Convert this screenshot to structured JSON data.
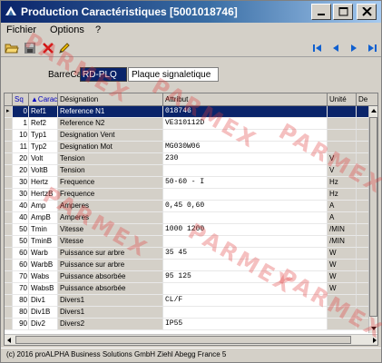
{
  "window": {
    "title": "Production Caractéristiques  [5001018746]"
  },
  "menu": {
    "items": [
      "Fichier",
      "Options",
      "?"
    ]
  },
  "form": {
    "barrecar_label": "BarreCar:",
    "barrecar_value": "RD-PLQ",
    "barrecar_desc": "Plaque signaletique"
  },
  "grid": {
    "headers": {
      "seq": "Sq",
      "carac": "Carac",
      "designation": "Désignation",
      "attribut": "Attribut",
      "unite": "Unité",
      "extra": "De"
    },
    "rows": [
      {
        "seq": "0",
        "carac": "Ref1",
        "designation": "Reference N1",
        "attribut": "018746",
        "unite": ""
      },
      {
        "seq": "1",
        "carac": "Ref2",
        "designation": "Reference N2",
        "attribut": "VE310112D",
        "unite": ""
      },
      {
        "seq": "10",
        "carac": "Typ1",
        "designation": "Designation Vent",
        "attribut": "",
        "unite": ""
      },
      {
        "seq": "11",
        "carac": "Typ2",
        "designation": "Designation Mot",
        "attribut": "MG030W06",
        "unite": ""
      },
      {
        "seq": "20",
        "carac": "Volt",
        "designation": "Tension",
        "attribut": "230",
        "unite": "V"
      },
      {
        "seq": "20",
        "carac": "VoltB",
        "designation": "Tension",
        "attribut": "",
        "unite": "V"
      },
      {
        "seq": "30",
        "carac": "Hertz",
        "designation": "Frequence",
        "attribut": "50-60 - I",
        "unite": "Hz"
      },
      {
        "seq": "30",
        "carac": "HertzB",
        "designation": "Frequence",
        "attribut": "",
        "unite": "Hz"
      },
      {
        "seq": "40",
        "carac": "Amp",
        "designation": "Amperes",
        "attribut": "0,45 0,60",
        "unite": "A"
      },
      {
        "seq": "40",
        "carac": "AmpB",
        "designation": "Amperes",
        "attribut": "",
        "unite": "A"
      },
      {
        "seq": "50",
        "carac": "Tmin",
        "designation": "Vitesse",
        "attribut": "1000 1200",
        "unite": "/MIN"
      },
      {
        "seq": "50",
        "carac": "TminB",
        "designation": "Vitesse",
        "attribut": "",
        "unite": "/MIN"
      },
      {
        "seq": "60",
        "carac": "Warb",
        "designation": "Puissance sur arbre",
        "attribut": "35 45",
        "unite": "W"
      },
      {
        "seq": "60",
        "carac": "WarbB",
        "designation": "Puissance sur arbre",
        "attribut": "",
        "unite": "W"
      },
      {
        "seq": "70",
        "carac": "Wabs",
        "designation": "Puissance absorbée",
        "attribut": "95 125",
        "unite": "W"
      },
      {
        "seq": "70",
        "carac": "WabsB",
        "designation": "Puissance absorbée",
        "attribut": "",
        "unite": "W"
      },
      {
        "seq": "80",
        "carac": "Div1",
        "designation": "Divers1",
        "attribut": "CL/F",
        "unite": ""
      },
      {
        "seq": "80",
        "carac": "Div1B",
        "designation": "Divers1",
        "attribut": "",
        "unite": ""
      },
      {
        "seq": "90",
        "carac": "Div2",
        "designation": "Divers2",
        "attribut": "IP55",
        "unite": ""
      }
    ]
  },
  "status": {
    "text": "(c) 2016 proALPHA Business Solutions GmbH  Ziehl Abegg France 5"
  },
  "watermark": {
    "text": "PARMEX"
  },
  "colors": {
    "title_start": "#0a246a",
    "title_end": "#a6caf0",
    "selection": "#0a246a",
    "chrome": "#d4d0c8",
    "nav_blue": "#1060d0",
    "delete_red": "#d01010"
  },
  "icons": {
    "toolbar": [
      "open-folder-icon",
      "save-icon",
      "delete-icon",
      "edit-icon"
    ],
    "nav": [
      "first-record-icon",
      "previous-record-icon",
      "next-record-icon",
      "last-record-icon"
    ]
  }
}
